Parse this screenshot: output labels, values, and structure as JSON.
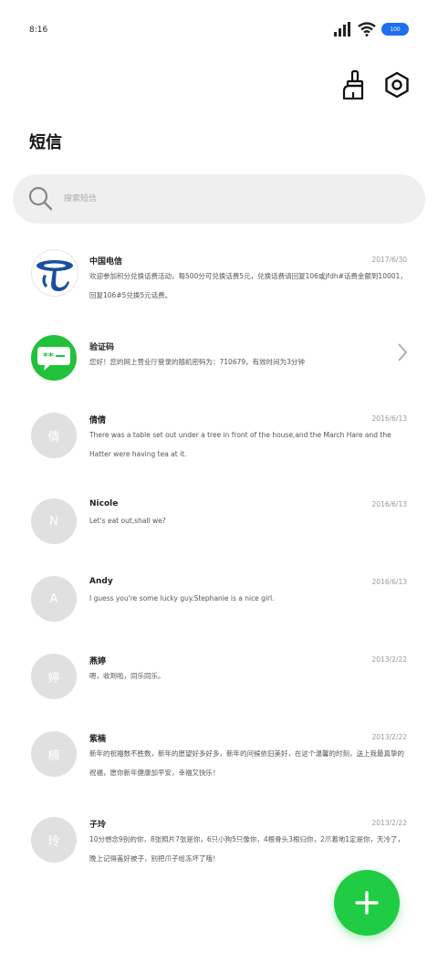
{
  "status_bar": {
    "time": "8:16",
    "battery": "100"
  },
  "header": {
    "title": "短信"
  },
  "search": {
    "placeholder": "搜索短信"
  },
  "messages": [
    {
      "name": "中国电信",
      "date": "2017/6/30",
      "preview": "欢迎参加积分兑换话费活动，每500分可兑换话费5元，兑换话费请回复106或jfdh#话费金额到10001，回复106#5兑换5元话费。",
      "avatar": "china-telecom-logo"
    },
    {
      "name": "验证码",
      "date": "",
      "preview": "您好！您的网上营业厅登录的随机密码为：710679，有效时间为3分钟",
      "avatar": "sms-bubble"
    },
    {
      "name": "倩倩",
      "date": "2016/6/13",
      "preview": "There was a table set out under a tree in front of the house,and the March Hare and the Hatter were having tea at it.",
      "avatar_letter": "倩"
    },
    {
      "name": "Nicole",
      "date": "2016/6/13",
      "preview": "Let's eat out,shall we?",
      "avatar_letter": "N"
    },
    {
      "name": "Andy",
      "date": "2016/6/13",
      "preview": "I guess you're some lucky guy.Stephanie is a nice girl.",
      "avatar_letter": "A"
    },
    {
      "name": "燕婷",
      "date": "2013/2/22",
      "preview": "嗯，收到啦，同乐同乐。",
      "avatar_letter": "婷"
    },
    {
      "name": "紫楠",
      "date": "2013/2/22",
      "preview": "新年的祝福数不胜数，新年的愿望好多好多，新年的问候依旧美好，在这个温馨的时刻，送上我最真挚的祝福，愿你新年健康加平安，幸福又快乐！",
      "avatar_letter": "楠"
    },
    {
      "name": "子玲",
      "date": "2013/2/22",
      "preview": "10分想念9别的你，8张照片7张是你，6只小狗5只像你，4根骨头3根归你，2爪着地1定是你，天冷了，晚上记得盖好被子，别把爪子给冻坏了哦！",
      "avatar_letter": "玲"
    }
  ],
  "colors": {
    "accent": "#20cc44",
    "telecom_blue": "#1a4fa0",
    "avatar_gray": "#e0e0e0"
  },
  "icons": {
    "clean": "broom-icon",
    "settings": "hexagon-settings-icon",
    "search": "search-icon",
    "fab": "plus-icon"
  }
}
